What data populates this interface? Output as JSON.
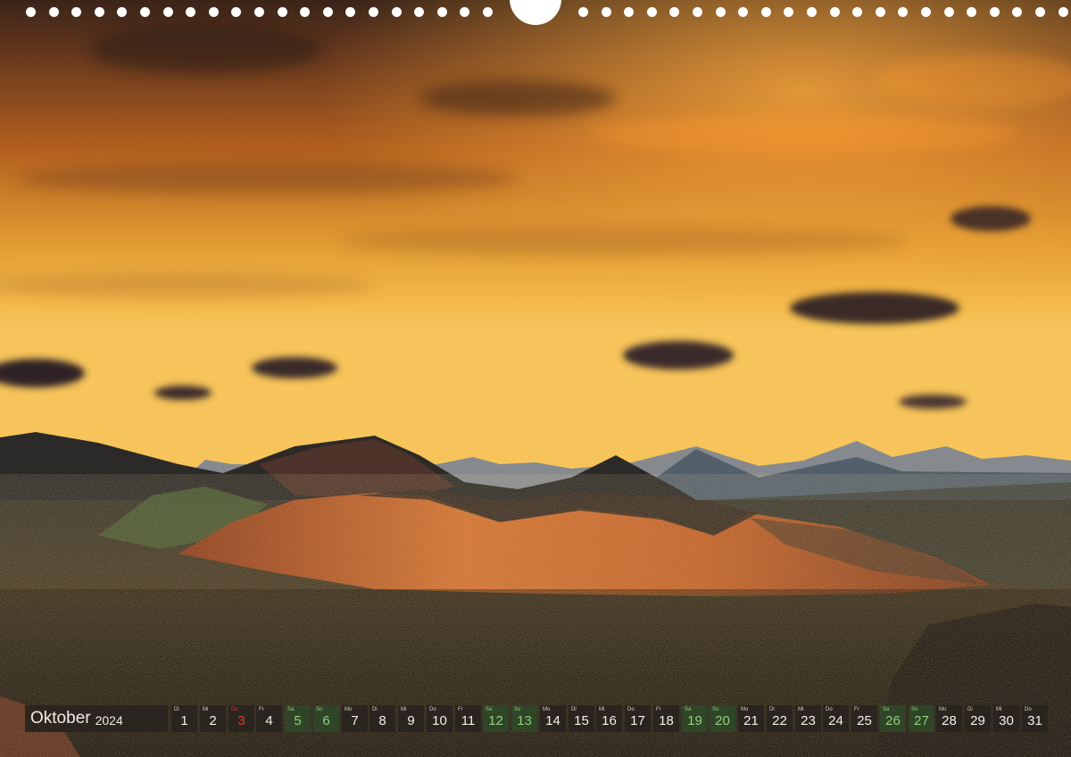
{
  "calendar": {
    "month": "Oktober",
    "year": "2024",
    "days": [
      {
        "dow": "Di",
        "num": "1",
        "type": "weekday"
      },
      {
        "dow": "Mi",
        "num": "2",
        "type": "weekday"
      },
      {
        "dow": "Do",
        "num": "3",
        "type": "holiday"
      },
      {
        "dow": "Fr",
        "num": "4",
        "type": "weekday"
      },
      {
        "dow": "Sa",
        "num": "5",
        "type": "weekend"
      },
      {
        "dow": "So",
        "num": "6",
        "type": "weekend"
      },
      {
        "dow": "Mo",
        "num": "7",
        "type": "weekday"
      },
      {
        "dow": "Di",
        "num": "8",
        "type": "weekday"
      },
      {
        "dow": "Mi",
        "num": "9",
        "type": "weekday"
      },
      {
        "dow": "Do",
        "num": "10",
        "type": "weekday"
      },
      {
        "dow": "Fr",
        "num": "11",
        "type": "weekday"
      },
      {
        "dow": "Sa",
        "num": "12",
        "type": "weekend"
      },
      {
        "dow": "So",
        "num": "13",
        "type": "weekend"
      },
      {
        "dow": "Mo",
        "num": "14",
        "type": "weekday"
      },
      {
        "dow": "Di",
        "num": "15",
        "type": "weekday"
      },
      {
        "dow": "Mi",
        "num": "16",
        "type": "weekday"
      },
      {
        "dow": "Do",
        "num": "17",
        "type": "weekday"
      },
      {
        "dow": "Fr",
        "num": "18",
        "type": "weekday"
      },
      {
        "dow": "Sa",
        "num": "19",
        "type": "weekend"
      },
      {
        "dow": "So",
        "num": "20",
        "type": "weekend"
      },
      {
        "dow": "Mo",
        "num": "21",
        "type": "weekday"
      },
      {
        "dow": "Di",
        "num": "22",
        "type": "weekday"
      },
      {
        "dow": "Mi",
        "num": "23",
        "type": "weekday"
      },
      {
        "dow": "Do",
        "num": "24",
        "type": "weekday"
      },
      {
        "dow": "Fr",
        "num": "25",
        "type": "weekday"
      },
      {
        "dow": "Sa",
        "num": "26",
        "type": "weekend"
      },
      {
        "dow": "So",
        "num": "27",
        "type": "weekend"
      },
      {
        "dow": "Mo",
        "num": "28",
        "type": "weekday"
      },
      {
        "dow": "Di",
        "num": "29",
        "type": "weekday"
      },
      {
        "dow": "Mi",
        "num": "30",
        "type": "weekday"
      },
      {
        "dow": "Do",
        "num": "31",
        "type": "weekday"
      }
    ]
  },
  "colors": {
    "sky_top": "#3a2418",
    "sky_glow": "#f0a030",
    "horizon": "#f6c45a",
    "mountains_far": "#5a6a7a",
    "volcano_red": "#c8602a",
    "lava_field": "#2a2418",
    "weekend_text": "#8ed07a",
    "holiday_text": "#e03a2a"
  }
}
